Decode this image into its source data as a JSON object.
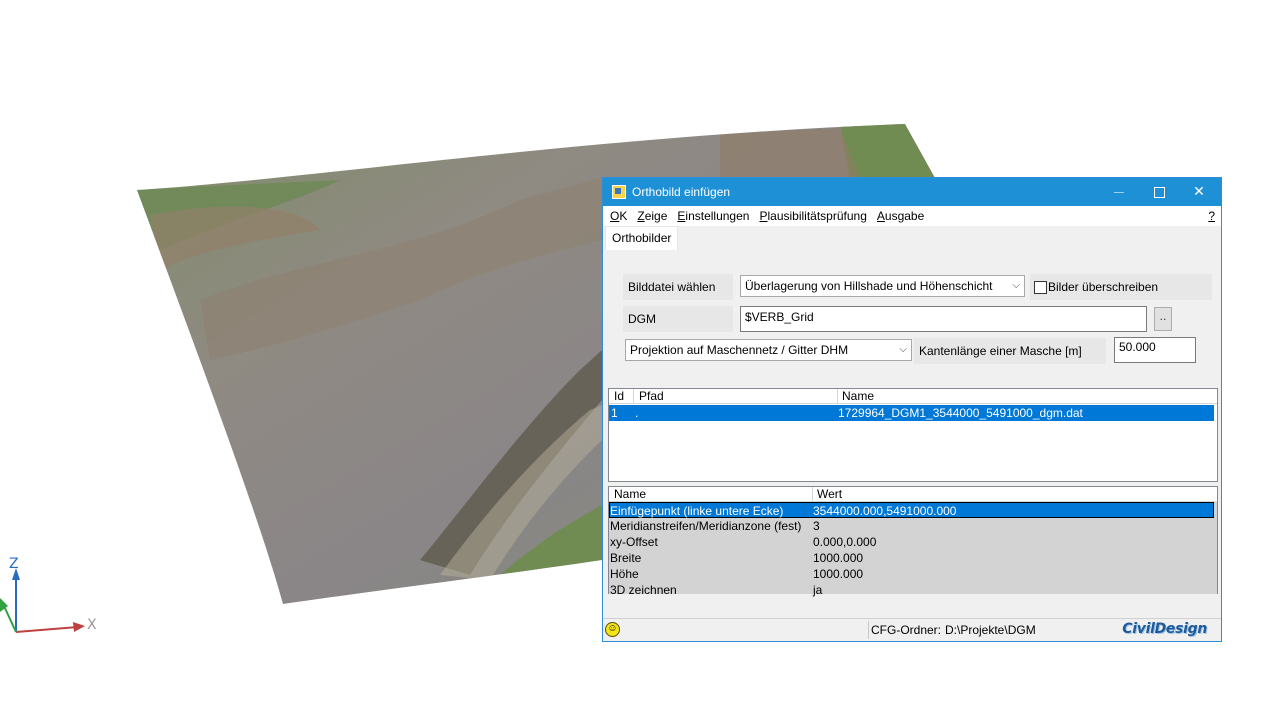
{
  "viewport": {
    "axis_z_label": "Z",
    "axis_x_label": "X"
  },
  "dialog": {
    "title": "Orthobild einfügen",
    "menu": [
      {
        "underline": "O",
        "rest": "K"
      },
      {
        "underline": "Z",
        "rest": "eige"
      },
      {
        "underline": "E",
        "rest": "instellungen"
      },
      {
        "underline": "P",
        "rest": "lausibilitätsprüfung"
      },
      {
        "underline": "A",
        "rest": "usgabe"
      }
    ],
    "help_label": "?",
    "tab_label": "Orthobilder",
    "form": {
      "bilddatei_label": "Bilddatei wählen",
      "bilddatei_value": "Überlagerung von Hillshade und Höhenschicht",
      "overwrite_label": "Bilder überschreiben",
      "overwrite_checked": false,
      "dgm_label": "DGM",
      "dgm_value": "$VERB_Grid",
      "browse_label": "..",
      "projection_value": "Projektion auf Maschennetz / Gitter DHM",
      "kantenlaenge_label": "Kantenlänge einer Masche [m]",
      "kantenlaenge_value": "50.000"
    },
    "files_table": {
      "headers": [
        "Id",
        "Pfad",
        "Name"
      ],
      "rows": [
        {
          "id": "1",
          "pfad": ".",
          "name": "1729964_DGM1_3544000_5491000_dgm.dat",
          "selected": true
        }
      ]
    },
    "props_table": {
      "headers": [
        "Name",
        "Wert"
      ],
      "rows": [
        {
          "name": "Einfügepunkt (linke untere Ecke)",
          "wert": "3544000.000,5491000.000",
          "selected": true
        },
        {
          "name": "Meridianstreifen/Meridianzone (fest)",
          "wert": "3",
          "selected": false
        },
        {
          "name": "xy-Offset",
          "wert": "0.000,0.000",
          "selected": false
        },
        {
          "name": "Breite",
          "wert": "1000.000",
          "selected": false
        },
        {
          "name": "Höhe",
          "wert": "1000.000",
          "selected": false
        },
        {
          "name": "3D zeichnen",
          "wert": "ja",
          "selected": false
        }
      ]
    },
    "status": {
      "cfg_label": "CFG-Ordner:",
      "cfg_value": "D:\\Projekte\\DGM",
      "brand": "CivilDesign"
    }
  },
  "colors": {
    "titlebar": "#1e90d6",
    "selection": "#0078d7",
    "props_background": "#d3d3d3"
  }
}
